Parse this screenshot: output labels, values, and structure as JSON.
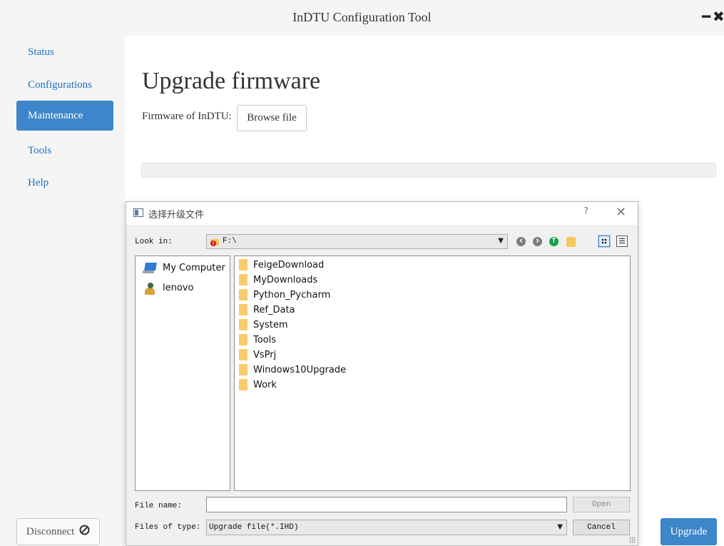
{
  "window": {
    "title": "InDTU Configuration Tool",
    "minimize_glyph": "━",
    "close_glyph": "✖"
  },
  "sidebar": {
    "items": [
      {
        "label": "Status",
        "active": false
      },
      {
        "label": "Configurations",
        "active": false
      },
      {
        "label": "Maintenance",
        "active": true
      },
      {
        "label": "Tools",
        "active": false
      },
      {
        "label": "Help",
        "active": false
      }
    ],
    "disconnect_label": "Disconnect"
  },
  "main": {
    "title": "Upgrade firmware",
    "firmware_label": "Firmware of InDTU:",
    "browse_label": "Browse file",
    "upgrade_label": "Upgrade",
    "progress": 0
  },
  "dialog": {
    "title": "选择升级文件",
    "help_glyph": "?",
    "close_glyph": "✕",
    "look_in_label": "Look in:",
    "current_path": "F:\\",
    "sidebar_places": [
      {
        "label": "My Computer",
        "icon": "computer-icon"
      },
      {
        "label": "lenovo",
        "icon": "user-icon"
      }
    ],
    "files": [
      "FeigeDownload",
      "MyDownloads",
      "Python_Pycharm",
      "Ref_Data",
      "System",
      "Tools",
      "VsPrj",
      "Windows10Upgrade",
      "Work"
    ],
    "file_name_label": "File name:",
    "file_name_value": "",
    "files_of_type_label": "Files of type:",
    "files_of_type_value": "Upgrade file(*.IHD)",
    "open_label": "Open",
    "cancel_label": "Cancel"
  },
  "colors": {
    "accent": "#3d86c9",
    "nav_text": "#1e6fbf",
    "folder": "#f8cc6a"
  }
}
